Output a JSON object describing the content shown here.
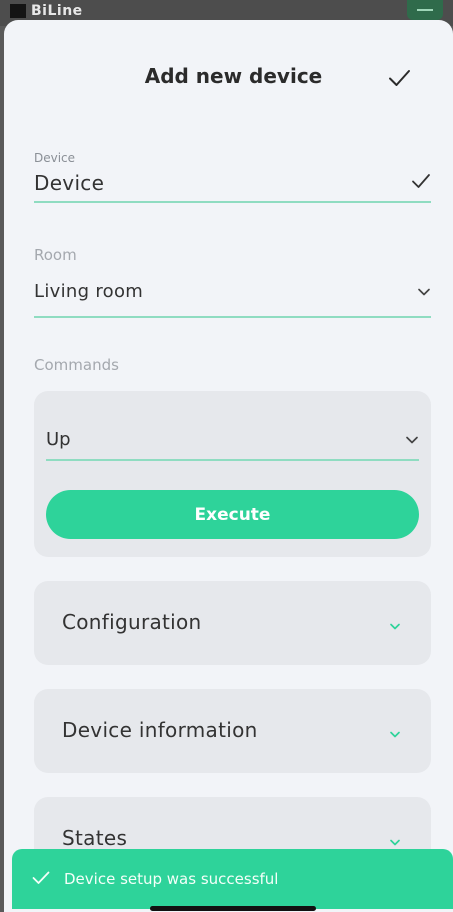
{
  "backdrop": {
    "logo_text": "BiLine"
  },
  "header": {
    "title": "Add new device"
  },
  "device_field": {
    "caption": "Device",
    "value": "Device"
  },
  "room_field": {
    "caption": "Room",
    "value": "Living room"
  },
  "commands": {
    "caption": "Commands",
    "selected": "Up",
    "execute_label": "Execute"
  },
  "sections": [
    {
      "label": "Configuration"
    },
    {
      "label": "Device information"
    },
    {
      "label": "States"
    }
  ],
  "toast": {
    "message": "Device setup was successful"
  },
  "colors": {
    "accent": "#2ed39a",
    "underline": "#8fdcc1",
    "sheet_bg": "#f2f4f8",
    "card_bg": "#e6e8ec"
  },
  "icons": {
    "confirm": "check-icon",
    "dropdown": "chevron-down-icon",
    "toast": "check-icon"
  }
}
